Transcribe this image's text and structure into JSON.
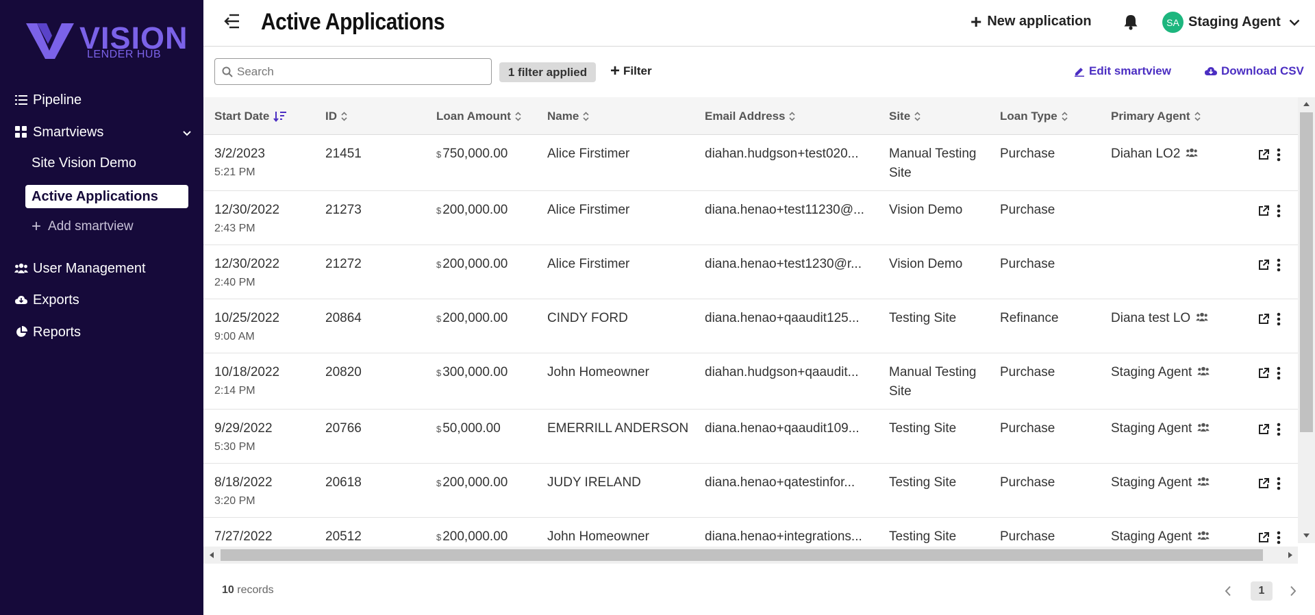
{
  "sidebar": {
    "brand": "VISION",
    "brand_sub": "LENDER HUB",
    "items": {
      "pipeline": "Pipeline",
      "smartviews": "Smartviews",
      "site_vision_demo": "Site Vision Demo",
      "active_applications": "Active Applications",
      "add_smartview": "Add smartview",
      "user_management": "User Management",
      "exports": "Exports",
      "reports": "Reports"
    }
  },
  "header": {
    "title": "Active Applications",
    "new_application": "New application",
    "user_initials": "SA",
    "user_name": "Staging Agent"
  },
  "toolbar": {
    "search_placeholder": "Search",
    "filter_applied": "1 filter applied",
    "filter": "Filter",
    "edit_smartview": "Edit smartview",
    "download_csv": "Download CSV"
  },
  "table": {
    "columns": [
      "Start Date",
      "ID",
      "Loan Amount",
      "Name",
      "Email Address",
      "Site",
      "Loan Type",
      "Primary Agent"
    ],
    "currency_symbol": "$",
    "rows": [
      {
        "date": "3/2/2023",
        "time": "5:21 PM",
        "id": "21451",
        "amount": "750,000.00",
        "name": "Alice Firstimer",
        "email": "diahan.hudgson+test020...",
        "site": "Manual Testing",
        "site2": "Site",
        "loan_type": "Purchase",
        "agent": "Diahan LO2"
      },
      {
        "date": "12/30/2022",
        "time": "2:43 PM",
        "id": "21273",
        "amount": "200,000.00",
        "name": "Alice Firstimer",
        "email": "diana.henao+test11230@...",
        "site": "Vision Demo",
        "site2": "",
        "loan_type": "Purchase",
        "agent": ""
      },
      {
        "date": "12/30/2022",
        "time": "2:40 PM",
        "id": "21272",
        "amount": "200,000.00",
        "name": "Alice Firstimer",
        "email": "diana.henao+test1230@r...",
        "site": "Vision Demo",
        "site2": "",
        "loan_type": "Purchase",
        "agent": ""
      },
      {
        "date": "10/25/2022",
        "time": "9:00 AM",
        "id": "20864",
        "amount": "200,000.00",
        "name": "CINDY FORD",
        "email": "diana.henao+qaaudit125...",
        "site": "Testing Site",
        "site2": "",
        "loan_type": "Refinance",
        "agent": "Diana test LO"
      },
      {
        "date": "10/18/2022",
        "time": "2:14 PM",
        "id": "20820",
        "amount": "300,000.00",
        "name": "John Homeowner",
        "email": "diahan.hudgson+qaaudit...",
        "site": "Manual Testing",
        "site2": "Site",
        "loan_type": "Purchase",
        "agent": "Staging Agent"
      },
      {
        "date": "9/29/2022",
        "time": "5:30 PM",
        "id": "20766",
        "amount": "50,000.00",
        "name": "EMERRILL ANDERSON",
        "email": "diana.henao+qaaudit109...",
        "site": "Testing Site",
        "site2": "",
        "loan_type": "Purchase",
        "agent": "Staging Agent"
      },
      {
        "date": "8/18/2022",
        "time": "3:20 PM",
        "id": "20618",
        "amount": "200,000.00",
        "name": "JUDY IRELAND",
        "email": "diana.henao+qatestinfor...",
        "site": "Testing Site",
        "site2": "",
        "loan_type": "Purchase",
        "agent": "Staging Agent"
      },
      {
        "date": "7/27/2022",
        "time": "",
        "id": "20512",
        "amount": "200,000.00",
        "name": "John Homeowner",
        "email": "diana.henao+integrations...",
        "site": "Testing Site",
        "site2": "",
        "loan_type": "Purchase",
        "agent": "Staging Agent"
      }
    ]
  },
  "footer": {
    "records_count": "10",
    "records_label": "records",
    "current_page": "1"
  },
  "colors": {
    "sidebar_bg": "#160a3a",
    "brand": "#7b62e8",
    "accent_link": "#4b2ec2",
    "avatar": "#1db67e"
  }
}
